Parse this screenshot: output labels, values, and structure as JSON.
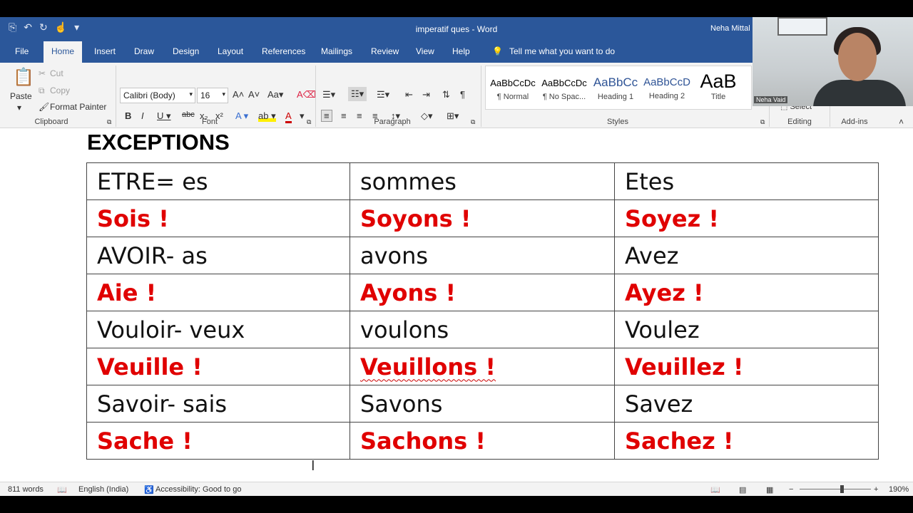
{
  "titlebar": {
    "doc_title": "imperatif ques  -  Word",
    "user": "Neha Mittal"
  },
  "tabs": [
    "File",
    "Home",
    "Insert",
    "Draw",
    "Design",
    "Layout",
    "References",
    "Mailings",
    "Review",
    "View",
    "Help"
  ],
  "active_tab": "Home",
  "tell_me": "Tell me what you want to do",
  "clipboard": {
    "paste": "Paste",
    "cut": "Cut",
    "copy": "Copy",
    "format_painter": "Format Painter",
    "label": "Clipboard"
  },
  "font": {
    "name": "Calibri (Body)",
    "size": "16",
    "label": "Font"
  },
  "paragraph": {
    "label": "Paragraph"
  },
  "styles": {
    "items": [
      {
        "sample": "AaBbCcDc",
        "name": "¶ Normal"
      },
      {
        "sample": "AaBbCcDc",
        "name": "¶ No Spac..."
      },
      {
        "sample": "AaBbCc",
        "name": "Heading 1"
      },
      {
        "sample": "AaBbCcD",
        "name": "Heading 2"
      },
      {
        "sample": "AaB",
        "name": "Title"
      }
    ],
    "label": "Styles"
  },
  "editing": {
    "select": "Select",
    "label": "Editing"
  },
  "addins": {
    "label": "Add-ins"
  },
  "webcam": {
    "name_tag": "Neha Vaid"
  },
  "document": {
    "heading": "EXCEPTIONS",
    "rows": [
      {
        "cells": [
          "ETRE= es",
          "sommes",
          "Etes"
        ],
        "red": false
      },
      {
        "cells": [
          "Sois !",
          "Soyons !",
          "Soyez !"
        ],
        "red": true
      },
      {
        "cells": [
          "AVOIR- as",
          "avons",
          "Avez"
        ],
        "red": false
      },
      {
        "cells": [
          "Aie !",
          "Ayons !",
          "Ayez !"
        ],
        "red": true
      },
      {
        "cells": [
          "Vouloir- veux",
          "voulons",
          "Voulez"
        ],
        "red": false
      },
      {
        "cells": [
          "Veuille !",
          "Veuillons !",
          "Veuillez !"
        ],
        "red": true
      },
      {
        "cells": [
          "Savoir- sais",
          "Savons",
          "Savez"
        ],
        "red": false
      },
      {
        "cells": [
          "Sache !",
          "Sachons !",
          "Sachez !"
        ],
        "red": true
      }
    ]
  },
  "status": {
    "words": "811 words",
    "language": "English (India)",
    "accessibility": "Accessibility: Good to go",
    "zoom": "190%"
  },
  "colors": {
    "ribbon_blue": "#2b579a",
    "red_text": "#e00000"
  }
}
